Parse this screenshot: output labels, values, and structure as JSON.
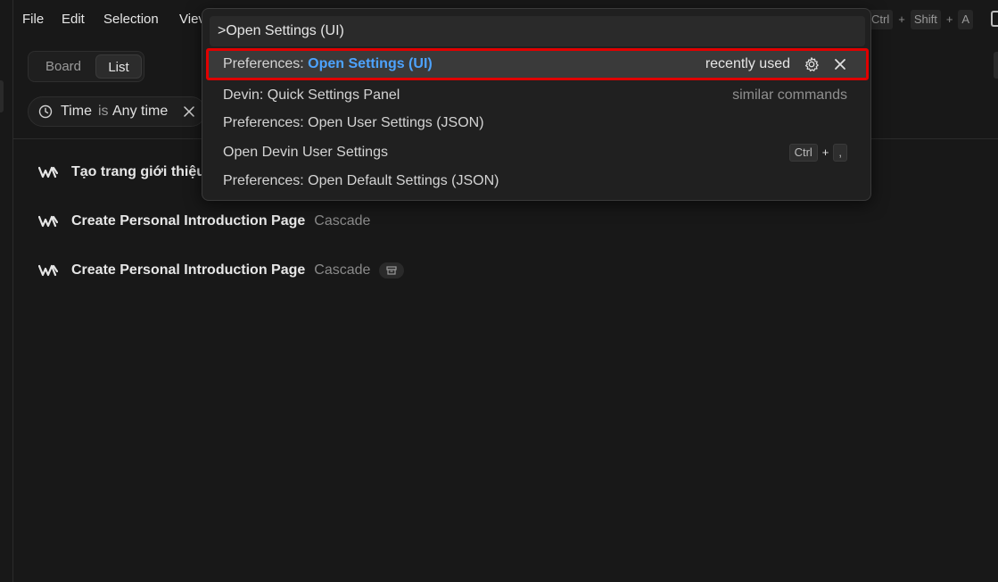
{
  "menubar": {
    "items": [
      "File",
      "Edit",
      "Selection",
      "Viev"
    ],
    "shortcut_hint": [
      "Ctrl",
      "+",
      "Shift",
      "+",
      "A"
    ]
  },
  "view_toggle": {
    "board_label": "Board",
    "list_label": "List",
    "selected": "List"
  },
  "filter": {
    "key": "Time",
    "operator": "is",
    "value": "Any time"
  },
  "tasks": [
    {
      "title": "Tạo trang giới thiệu",
      "source": "",
      "archived": false
    },
    {
      "title": "Create Personal Introduction Page",
      "source": "Cascade",
      "archived": false
    },
    {
      "title": "Create Personal Introduction Page",
      "source": "Cascade",
      "archived": true
    }
  ],
  "command_palette": {
    "input_value": ">Open Settings (UI)",
    "items": [
      {
        "prefix": "Preferences: ",
        "highlight": "Open Settings (UI)",
        "right_text": "recently used",
        "selected": true
      },
      {
        "prefix": "Devin: Quick Settings Panel",
        "highlight": "",
        "right_text": "similar commands",
        "selected": false
      },
      {
        "prefix": "Preferences: Open User Settings (JSON)",
        "highlight": "",
        "right_text": "",
        "selected": false
      },
      {
        "prefix": "Open Devin User Settings",
        "highlight": "",
        "right_text": "",
        "keybinding": [
          "Ctrl",
          "+",
          ","
        ],
        "selected": false
      },
      {
        "prefix": "Preferences: Open Default Settings (JSON)",
        "highlight": "",
        "right_text": "",
        "selected": false
      }
    ]
  },
  "colors": {
    "background": "#181818",
    "palette_bg": "#202020",
    "highlight_blue": "#4da3ff",
    "selection_border": "#e00000"
  }
}
